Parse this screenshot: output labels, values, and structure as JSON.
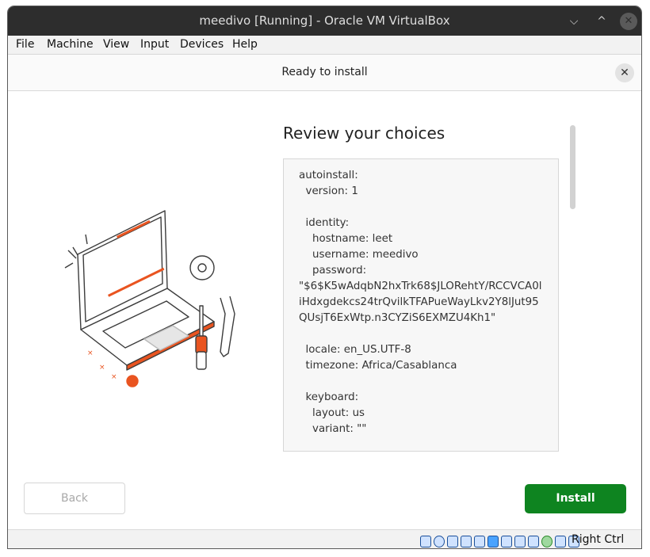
{
  "window": {
    "title": "meedivo [Running] - Oracle VM VirtualBox",
    "minimize_glyph": "⌵",
    "maximize_glyph": "^",
    "close_glyph": "✕"
  },
  "menu": [
    "File",
    "Machine",
    "View",
    "Input",
    "Devices",
    "Help"
  ],
  "header": {
    "title": "Ready to install",
    "close_glyph": "✕"
  },
  "main": {
    "heading": "Review your choices",
    "config_text": "autoinstall:\n  version: 1\n\n  identity:\n    hostname: leet\n    username: meedivo\n    password:\n\"$6$K5wAdqbN2hxTrk68$JLORehtY/RCCVCA0l\niHdxgdekcs24trQvilkTFAPueWayLkv2Y8lJut95\nQUsjT6ExWtp.n3CYZiS6EXMZU4Kh1\"\n\n  locale: en_US.UTF-8\n  timezone: Africa/Casablanca\n\n  keyboard:\n    layout: us\n    variant: \"\""
  },
  "buttons": {
    "back": "Back",
    "install": "Install"
  },
  "statusbar": {
    "host_key": "Right Ctrl",
    "icons": [
      "hard-disk-icon",
      "optical-drive-icon",
      "audio-icon",
      "network-icon",
      "usb-icon",
      "shared-folders-icon",
      "display-icon",
      "video-capture-icon",
      "vrde-icon",
      "recording-icon",
      "mouse-integration-icon",
      "keyboard-icon"
    ]
  },
  "colors": {
    "install_button": "#0e8420",
    "titlebar": "#2d2d2d",
    "illustration_accent": "#e95420"
  }
}
